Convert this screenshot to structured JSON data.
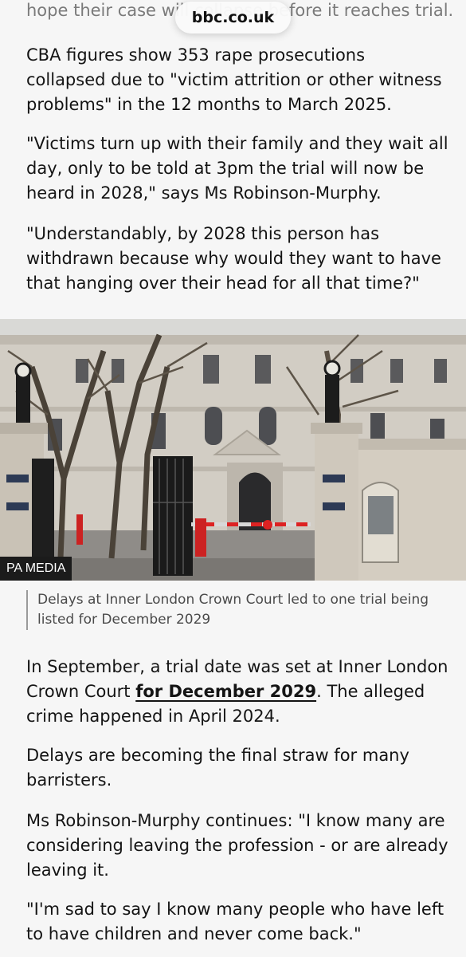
{
  "browser": {
    "url_label": "bbc.co.uk"
  },
  "article": {
    "top_fragment": "hope their case will collapse before it reaches trial.",
    "paragraphs": [
      "CBA figures show 353 rape prosecutions collapsed due to \"victim attrition or other witness problems\" in the 12 months to March 2025.",
      "\"Victims turn up with their family and they wait all day, only to be told at 3pm the trial will now be heard in 2028,\" says Ms Robinson-Murphy.",
      "\"Understandably, by 2028 this person has withdrawn because why would they want to have that hanging over their head for all that time?\""
    ],
    "image": {
      "credit": "PA MEDIA",
      "caption": "Delays at Inner London Crown Court led to one trial being listed for December 2029"
    },
    "para_after_1_before_link": "In September, a trial date was set at Inner London Crown Court ",
    "para_after_1_link": "for December 2029",
    "para_after_1_after_link": ". The alleged crime happened in April 2024.",
    "paragraphs_after": [
      "Delays are becoming the final straw for many barristers.",
      "Ms Robinson-Murphy continues: \"I know many are considering leaving the profession - or are already leaving it.",
      "\"I'm sad to say I know many people who have left to have children and never come back.\""
    ]
  }
}
